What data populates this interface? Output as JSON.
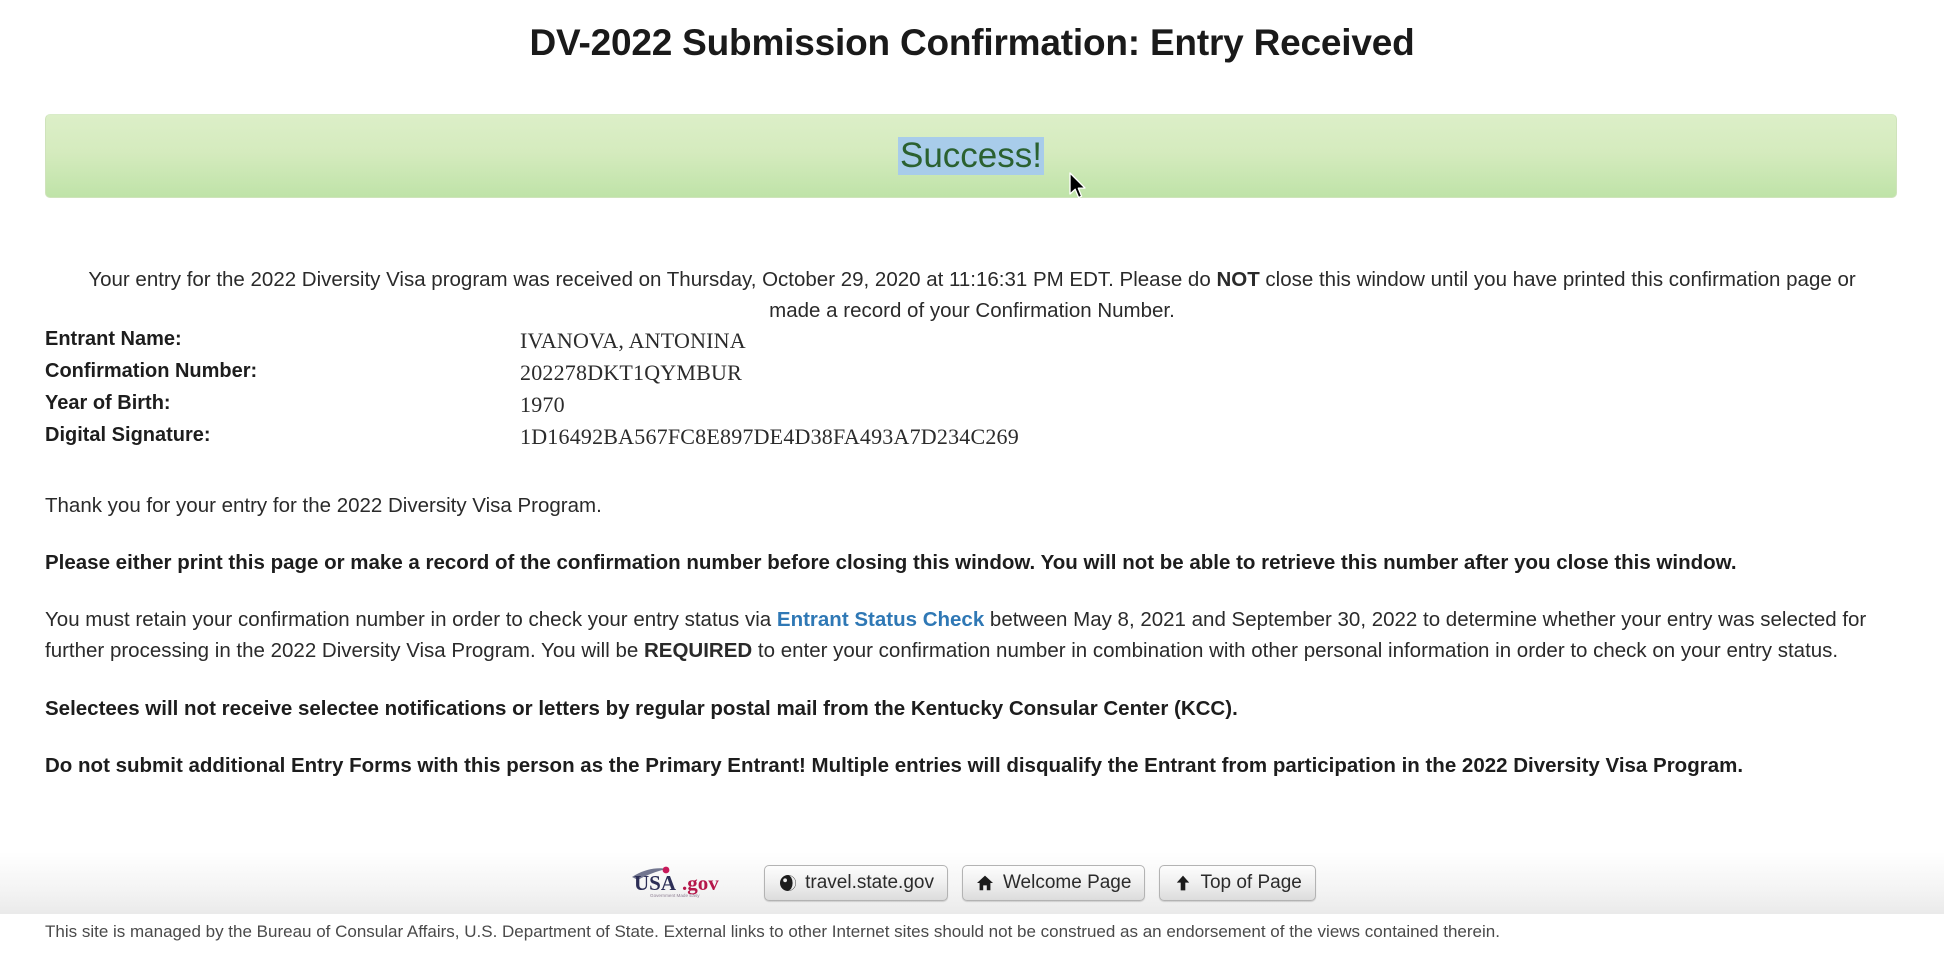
{
  "page": {
    "title": "DV-2022 Submission Confirmation: Entry Received"
  },
  "banner": {
    "status_text": "Success!",
    "background_color": "#d5ebbe",
    "text_color": "#2b6130",
    "selection_highlight_color": "#a8ccea"
  },
  "intro": {
    "part1": "Your entry for the 2022 Diversity Visa program was received on Thursday, October 29, 2020 at 11:16:31 PM EDT. Please do ",
    "emphasis": "NOT",
    "part2": " close this window until you have printed this confirmation page or made a record of your Confirmation Number."
  },
  "details": {
    "rows": [
      {
        "label": "Entrant Name:",
        "value": "IVANOVA, ANTONINA"
      },
      {
        "label": "Confirmation Number:",
        "value": "202278DKT1QYMBUR"
      },
      {
        "label": "Year of Birth:",
        "value": "1970"
      },
      {
        "label": "Digital Signature:",
        "value": "1D16492BA567FC8E897DE4D38FA493A7D234C269"
      }
    ]
  },
  "body": {
    "thanks": "Thank you for your entry for the 2022 Diversity Visa Program.",
    "print_warning": "Please either print this page or make a record of the confirmation number before closing this window. You will not be able to retrieve this number after you close this window.",
    "status_check": {
      "part1": "You must retain your confirmation number in order to check your entry status via ",
      "link_text": "Entrant Status Check",
      "link_color": "#2f78b5",
      "part2": " between May 8, 2021 and September 30, 2022 to determine whether your entry was selected for further processing in the 2022 Diversity Visa Program. You will be ",
      "emphasis": "REQUIRED",
      "part3": " to enter your confirmation number in combination with other personal information in order to check on your entry status."
    },
    "selectee_notice": "Selectees will not receive selectee notifications or letters by regular postal mail from the Kentucky Consular Center (KCC).",
    "duplicate_warning": "Do not submit additional Entry Forms with this person as the Primary Entrant! Multiple entries will disqualify the Entrant from participation in the 2022 Diversity Visa Program."
  },
  "footer": {
    "logo_text_primary": "USA",
    "logo_text_secondary": ".gov",
    "buttons": [
      {
        "label": "travel.state.gov",
        "icon": "globe-icon"
      },
      {
        "label": "Welcome Page",
        "icon": "home-icon"
      },
      {
        "label": "Top of Page",
        "icon": "arrow-up-icon"
      }
    ],
    "disclaimer": "This site is managed by the Bureau of Consular Affairs, U.S. Department of State. External links to other Internet sites should not be construed as an endorsement of the views contained therein."
  }
}
